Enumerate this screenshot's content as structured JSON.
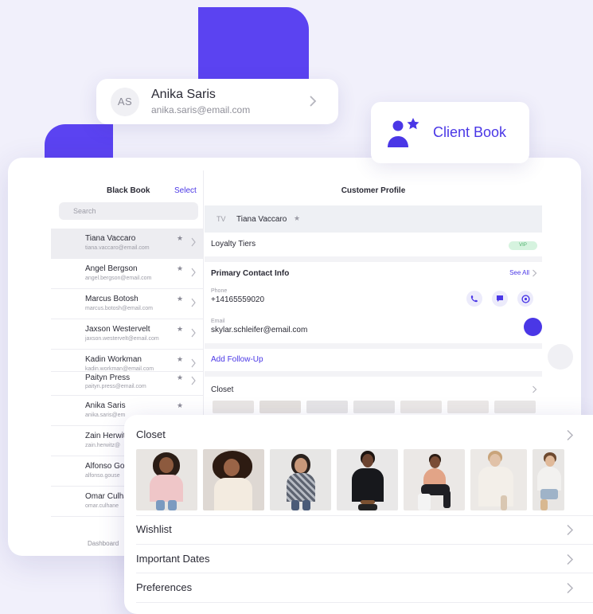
{
  "contact_card": {
    "initials": "AS",
    "name": "Anika Saris",
    "email": "anika.saris@email.com"
  },
  "client_book": {
    "label": "Client Book"
  },
  "sidebar": {
    "title": "Black Book",
    "select_label": "Select",
    "search_placeholder": "Search",
    "items": [
      {
        "name": "Tiana Vaccaro",
        "email": "tiana.vaccaro@email.com",
        "star": "★"
      },
      {
        "name": "Angel Bergson",
        "email": "angel.bergson@email.com",
        "star": "★"
      },
      {
        "name": "Marcus Botosh",
        "email": "marcus.botosh@email.com",
        "star": "★"
      },
      {
        "name": "Jaxson Westervelt",
        "email": "jaxson.westervelt@email.com",
        "star": "★"
      },
      {
        "name": "Kadin Workman",
        "email": "kadin.workman@email.com",
        "star": "★"
      },
      {
        "name": "Paityn Press",
        "email": "paityn.press@email.com",
        "star": "★"
      },
      {
        "name": "Anika Saris",
        "email": "anika.saris@em",
        "star": "★"
      },
      {
        "name": "Zain Herwit",
        "email": "zain.herwitz@",
        "star": ""
      },
      {
        "name": "Alfonso Go",
        "email": "alfonso.gouse",
        "star": ""
      },
      {
        "name": "Omar Culha",
        "email": "omar.culhane",
        "star": ""
      }
    ],
    "footer": "Dashboard"
  },
  "profile": {
    "title": "Customer Profile",
    "client_initials": "TV",
    "client_name": "Tiana Vaccaro",
    "client_star": "★",
    "loyalty_label": "Loyalty Tiers",
    "loyalty_badge": "VIP",
    "contact_heading": "Primary Contact Info",
    "see_all": "See All",
    "phone_label": "Phone",
    "phone": "+14165559020",
    "email_label": "Email",
    "email": "skylar.schleifer@email.com",
    "follow_up": "Add Follow-Up",
    "closet_label": "Closet"
  },
  "panel": {
    "closet": "Closet",
    "wishlist": "Wishlist",
    "important_dates": "Important Dates",
    "preferences": "Preferences"
  },
  "colors": {
    "accent": "#5b43f1",
    "background": "#f1f0fb",
    "vip_badge": "#d6f3df"
  },
  "icons": [
    "chevron-right-icon",
    "client-book-icon",
    "star-icon",
    "phone-icon",
    "message-icon",
    "whatsapp-icon"
  ]
}
